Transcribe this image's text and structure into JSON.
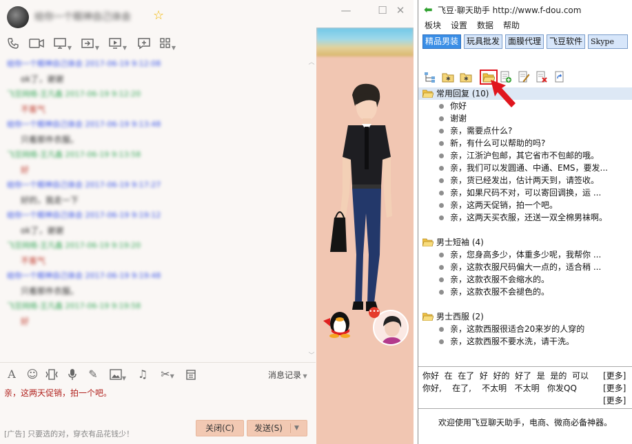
{
  "qq": {
    "contact_name": "给你一个眼神自己体会",
    "window_controls": [
      "minimize",
      "maximize",
      "close"
    ],
    "toolbar_icons": [
      "phone-icon",
      "video-icon",
      "screen-share-icon",
      "file-transfer-icon",
      "remote-desktop-icon",
      "message-plus-icon",
      "apps-icon"
    ],
    "messages": [
      {
        "kind": "head",
        "color": "blue",
        "text": "给你一个眼神自己体会 2017-06-19 9:12:08"
      },
      {
        "kind": "body",
        "color": "normal",
        "text": "ok了，谢谢"
      },
      {
        "kind": "head",
        "color": "green",
        "text": "飞豆网络-王凡鑫 2017-06-19 9:12:20"
      },
      {
        "kind": "body",
        "color": "red",
        "text": "不客气"
      },
      {
        "kind": "head",
        "color": "blue",
        "text": "给你一个眼神自己体会 2017-06-19 9:13:48"
      },
      {
        "kind": "body",
        "color": "normal",
        "text": "只看那件衣服。"
      },
      {
        "kind": "head",
        "color": "green",
        "text": "飞豆网络-王凡鑫 2017-06-19 9:13:58"
      },
      {
        "kind": "body",
        "color": "red",
        "text": "好"
      },
      {
        "kind": "head",
        "color": "blue",
        "text": "给你一个眼神自己体会 2017-06-19 9:17:27"
      },
      {
        "kind": "body",
        "color": "normal",
        "text": "好的，我走一下"
      },
      {
        "kind": "head",
        "color": "blue",
        "text": "给你一个眼神自己体会 2017-06-19 9:19:12"
      },
      {
        "kind": "body",
        "color": "normal",
        "text": "ok了，谢谢"
      },
      {
        "kind": "head",
        "color": "green",
        "text": "飞豆网络-王凡鑫 2017-06-19 9:19:20"
      },
      {
        "kind": "body",
        "color": "red",
        "text": "不客气"
      },
      {
        "kind": "head",
        "color": "blue",
        "text": "给你一个眼神自己体会 2017-06-19 9:19:48"
      },
      {
        "kind": "body",
        "color": "normal",
        "text": "只看那件衣服。"
      },
      {
        "kind": "head",
        "color": "green",
        "text": "飞豆网络-王凡鑫 2017-06-19 9:19:58"
      },
      {
        "kind": "body",
        "color": "red",
        "text": "好"
      }
    ],
    "input_icons": [
      "font-icon",
      "emoji-icon",
      "shake-icon",
      "mic-icon",
      "pen-icon",
      "image-icon",
      "music-icon",
      "scissors-icon",
      "calendar-icon"
    ],
    "history_label": "消息记录",
    "input_text": "亲，这两天促销，拍一个吧。",
    "ad_text": "[广告] 只要选的对，穿衣有品花钱少！",
    "close_label": "关闭(C)",
    "send_label": "发送(S)"
  },
  "fd": {
    "title": "飞豆·聊天助手 http://www.f-dou.com",
    "menu": [
      "板块",
      "设置",
      "数据",
      "帮助"
    ],
    "tabs": [
      "精品男装",
      "玩具批发",
      "面膜代理",
      "飞豆软件",
      "Skype"
    ],
    "active_tab": 0,
    "icons": [
      "tree-icon",
      "folder-star-icon",
      "folder-star2-icon",
      "folder-open-icon",
      "doc-add-icon",
      "doc-edit-icon",
      "doc-delete-icon",
      "refresh-icon"
    ],
    "groups": [
      {
        "name": "常用回复 (10)",
        "selected": true,
        "items": [
          "你好",
          "谢谢",
          "亲，需要点什么?",
          "新，有什么可以帮助的吗?",
          "亲，江浙沪包邮，其它省市不包邮的哦。",
          "亲，我们可以发圆通、中通、EMS，要发...",
          "亲，货已经发出，估计两天到，请签收。",
          "亲，如果尺码不对，可以寄回调换，运 ...",
          "亲，这两天促销，拍一个吧。",
          "亲，这两天买衣服，还送一双全棉男袜啊。"
        ]
      },
      {
        "name": "男士短袖 (4)",
        "selected": false,
        "items": [
          "亲，您身高多少，体重多少呢，我帮你 ...",
          "亲，这款衣服尺码偏大一点的，适合稍 ...",
          "亲，这款衣服不会缩水的。",
          "亲，这款衣服不会褪色的。"
        ]
      },
      {
        "name": "男士西服 (2)",
        "selected": false,
        "items": [
          "亲，这款西服很适合20来岁的人穿的",
          "亲，这款西服不要水洗，请干洗。"
        ]
      }
    ],
    "quick_rows": [
      "你好  在  在了  好  好的  好了  是  是的  可以",
      "你好,    在了,    不太明   不太明   你发QQ",
      ""
    ],
    "more_label": "[更多]",
    "welcome": "欢迎使用飞豆聊天助手，电商、微商必备神器。"
  }
}
